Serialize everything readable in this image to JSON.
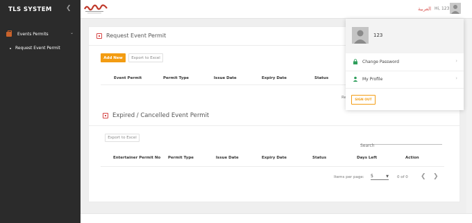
{
  "app": {
    "brand": "TLS SYSTEM",
    "collapse_icon": "chevron-left-icon"
  },
  "sidebar": {
    "group_label": "Events Permits",
    "group_icon": "briefcase-icon",
    "items": [
      {
        "label": "Request Event Permit"
      }
    ]
  },
  "topbar": {
    "language": "العربية",
    "greeting": "Hi, 123"
  },
  "request_section": {
    "title": "Request Event Permit",
    "add_new": "Add New",
    "export": "Export to Excel",
    "columns": [
      "Event Permit",
      "Permit Type",
      "Issue Date",
      "Expiry Date",
      "Status"
    ],
    "partial_text": "Re"
  },
  "expired_section": {
    "title": "Expired / Cancelled Event Permit",
    "export": "Export to Excel",
    "search_placeholder": "Search",
    "columns": [
      "Entertainer Permit No",
      "Permit Type",
      "Issue Date",
      "Expiry Date",
      "Status",
      "Days Left",
      "Action"
    ]
  },
  "paginator": {
    "items_per_page_label": "Items per page:",
    "page_size": "5",
    "range": "0 of 0"
  },
  "profile_menu": {
    "username": "123",
    "items": [
      {
        "label": "Change Password",
        "icon": "lock-icon"
      },
      {
        "label": "My Profile",
        "icon": "user-icon"
      }
    ],
    "sign_out": "SIGN OUT"
  },
  "colors": {
    "sidebar_bg": "#2b2b2b",
    "accent": "#f39c12",
    "section_icon": "#d64545",
    "arabic_link": "#d9534f",
    "lock_icon": "#2e9e5b"
  }
}
